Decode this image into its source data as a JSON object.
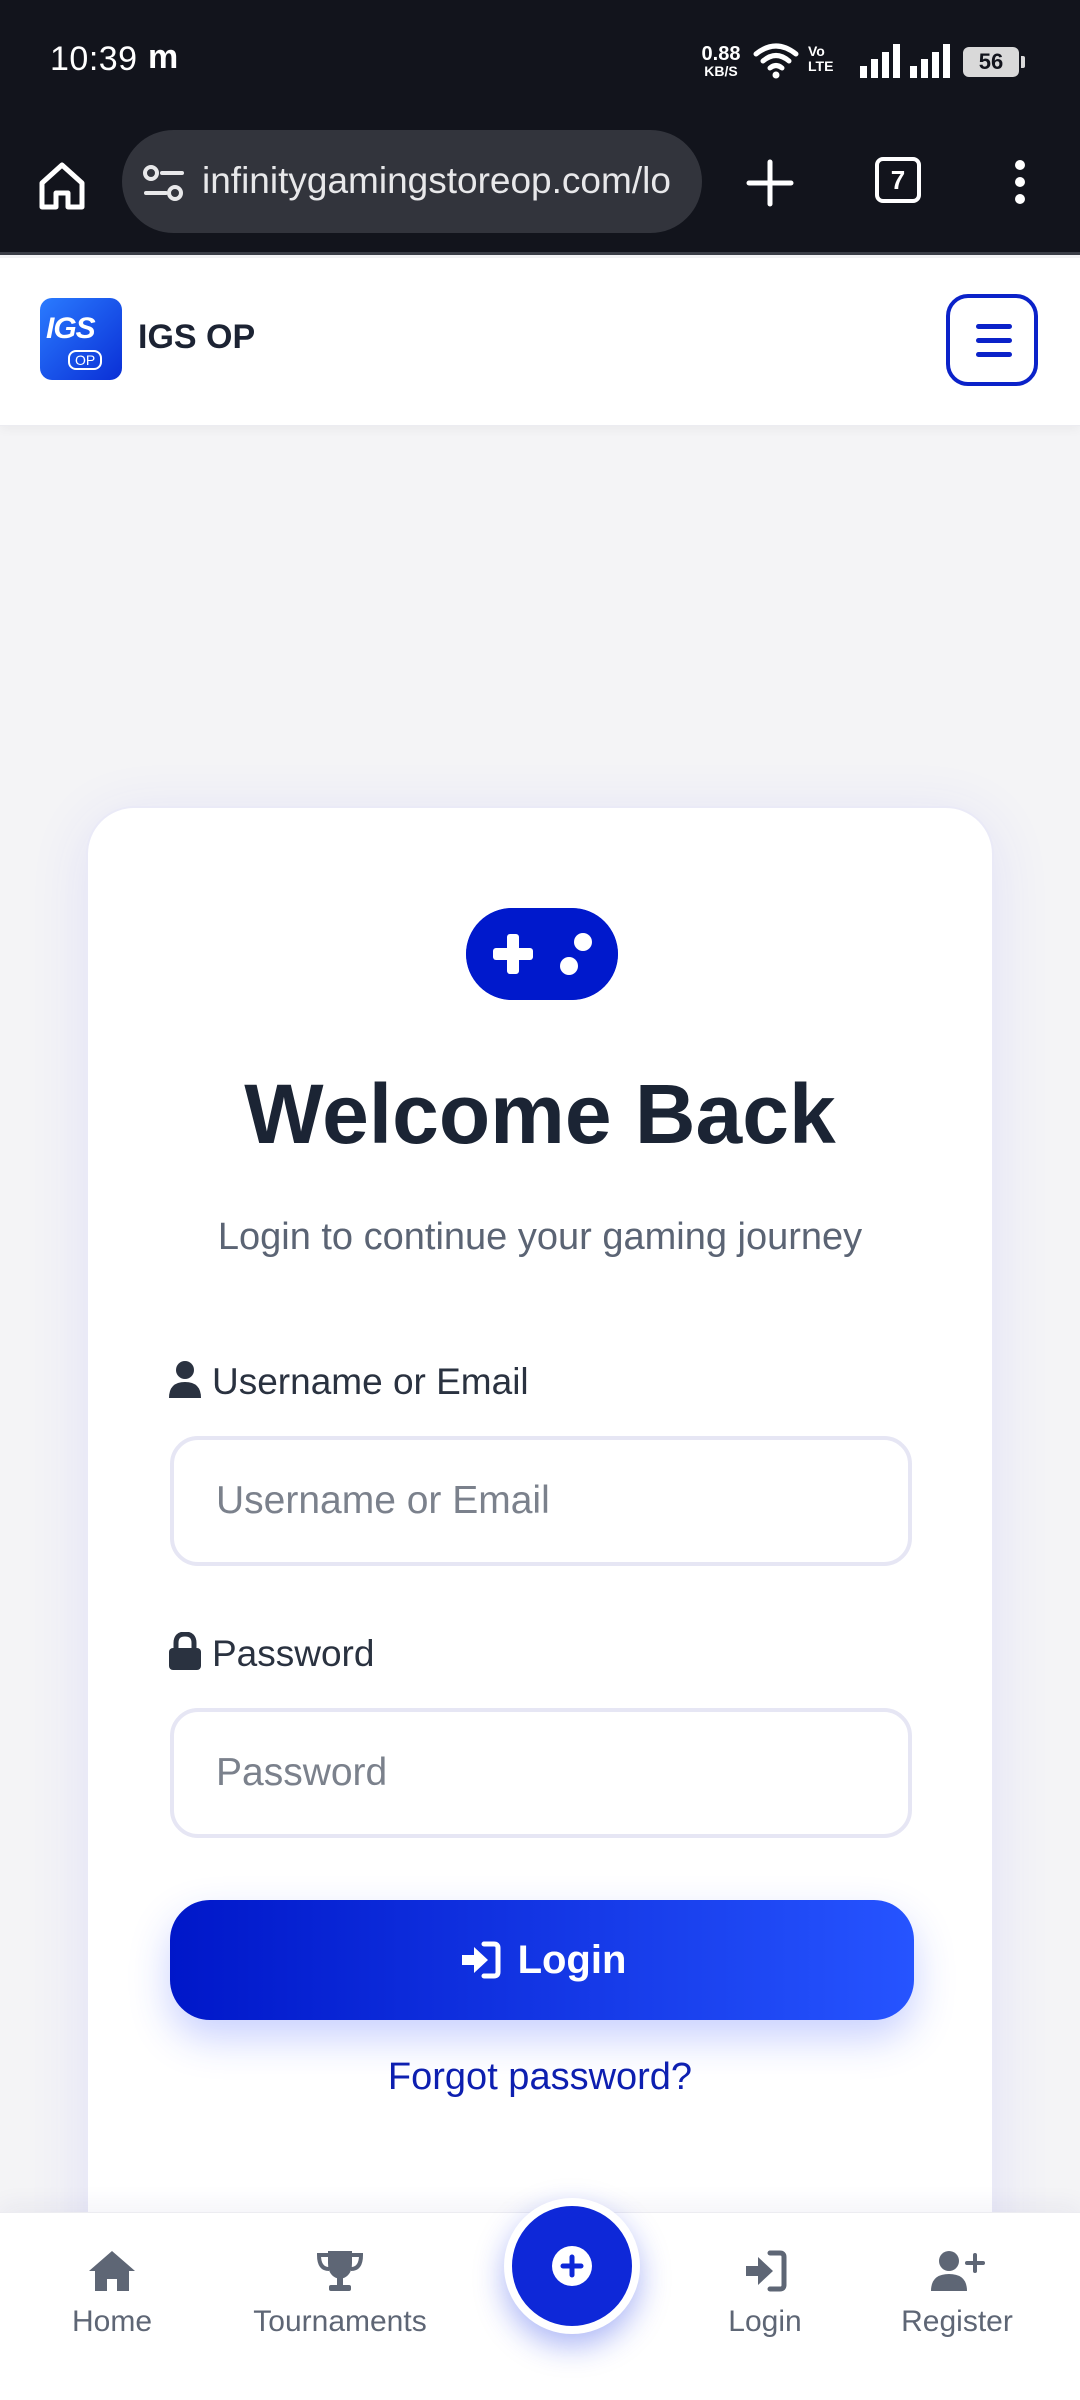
{
  "status_bar": {
    "time": "10:39",
    "app_indicator": "m",
    "net_speed_value": "0.88",
    "net_speed_unit": "KB/S",
    "volte_line1": "Vo",
    "volte_line2": "LTE",
    "battery": "56"
  },
  "browser": {
    "url": "infinitygamingstoreop.com/lo",
    "tab_count": "7"
  },
  "site_header": {
    "logo_text": "IGS",
    "logo_sub": "OP",
    "brand_name": "IGS OP"
  },
  "login_card": {
    "title": "Welcome Back",
    "subtitle": "Login to continue your gaming journey",
    "username_label": "Username or Email",
    "username_placeholder": "Username or Email",
    "password_label": "Password",
    "password_placeholder": "Password",
    "login_button": "Login",
    "forgot_link": "Forgot password?"
  },
  "bottom_nav": {
    "items": [
      {
        "label": "Home",
        "icon": "home-icon"
      },
      {
        "label": "Tournaments",
        "icon": "trophy-icon"
      },
      {
        "label": "Login",
        "icon": "sign-in-icon"
      },
      {
        "label": "Register",
        "icon": "user-plus-icon"
      }
    ],
    "center_icon": "plus-circle-icon"
  },
  "colors": {
    "primary": "#0b22c9",
    "primary_light": "#2654ff",
    "heading": "#1b2434",
    "muted": "#5b6474",
    "browser_bg": "#12141c"
  }
}
